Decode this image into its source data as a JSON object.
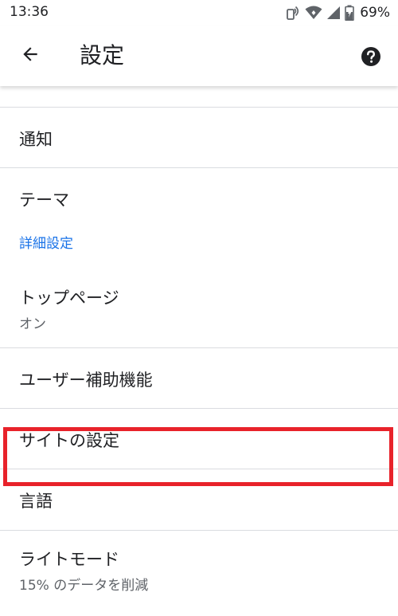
{
  "status_bar": {
    "time": "13:36",
    "battery": "69%",
    "icons": [
      "nfc-icon",
      "wifi-icon",
      "cellular-signal-icon",
      "battery-charging-icon"
    ]
  },
  "header": {
    "back_icon": "arrow-back-icon",
    "title": "設定",
    "help_icon": "help-circle-icon"
  },
  "settings": {
    "notifications": "通知",
    "theme": "テーマ",
    "advanced_header": "詳細設定",
    "homepage": {
      "title": "トップページ",
      "value": "オン"
    },
    "accessibility": "ユーザー補助機能",
    "site_settings": "サイトの設定",
    "languages": "言語",
    "lite_mode": {
      "title": "ライトモード",
      "value": "15% のデータを削減"
    }
  },
  "colors": {
    "accent": "#1a73e8",
    "highlight": "#e8222a",
    "divider": "#dadce0"
  }
}
